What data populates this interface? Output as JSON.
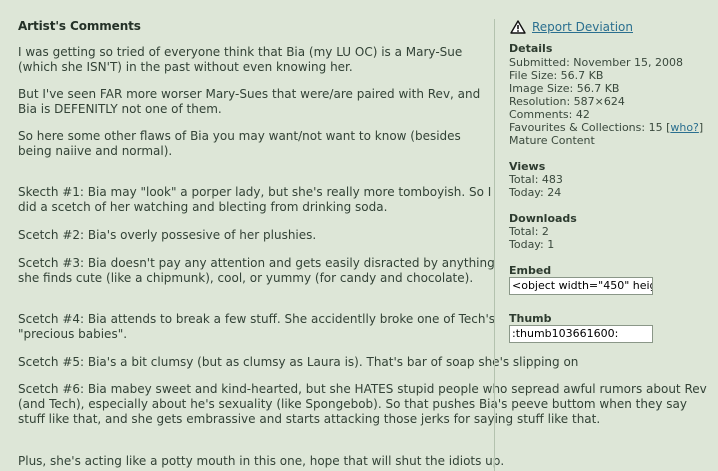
{
  "comments": {
    "heading": "Artist's Comments",
    "paragraphs": [
      "I was getting so tried of everyone think that Bia (my LU OC) is a Mary-Sue (which she ISN'T) in the past without even knowing her.",
      "But I've seen FAR more worser Mary-Sues that were/are paired with Rev, and Bia is DEFENITLY not one of them.",
      "So here some other flaws of Bia you may want/not want to know (besides being naiive and normal).",
      "Skecth #1: Bia may \"look\" a porper lady, but she's really more tomboyish. So I did a scetch of her watching and blecting from drinking soda.",
      "Scetch #2: Bia's overly possesive of her plushies.",
      "Scetch #3: Bia doesn't pay any attention and gets easily disracted by anything she finds cute (like a chipmunk), cool, or yummy (for candy and chocolate).",
      "Scetch #4: Bia attends to break a few stuff. She accidentlly broke one of Tech's \"precious babies\".",
      "Scetch #5: Bia's a bit clumsy (but as clumsy as Laura is). That's bar of soap she's slipping on",
      "Scetch #6: Bia mabey sweet and kind-hearted, but she HATES stupid people who sepread awful rumors about Rev (and Tech), especially about he's sexuality (like Spongebob). So that pushes Bia's peeve buttom when they say stuff like that, and she gets embrassive and starts attacking those jerks for saying stuff like that.",
      "Plus, she's acting like a potty mouth in this one, hope that will shut the idiots up."
    ]
  },
  "sidebar": {
    "report_label": "Report Deviation",
    "report_icon": "warning-triangle-icon",
    "details": {
      "label": "Details",
      "submitted": "Submitted: November 15, 2008",
      "file_size": "File Size: 56.7 KB",
      "image_size": "Image Size: 56.7 KB",
      "resolution": "Resolution: 587×624",
      "comments": "Comments: 42",
      "favourites": "Favourites & Collections: 15 [",
      "who": "who?",
      "favourites_close": "]",
      "mature": "Mature Content"
    },
    "views": {
      "label": "Views",
      "total": "Total: 483",
      "today": "Today: 24"
    },
    "downloads": {
      "label": "Downloads",
      "total": "Total: 2",
      "today": "Today: 1"
    },
    "embed": {
      "label": "Embed",
      "value": "<object width=\"450\" heig"
    },
    "thumb": {
      "label": "Thumb",
      "value": ":thumb103661600:"
    }
  }
}
